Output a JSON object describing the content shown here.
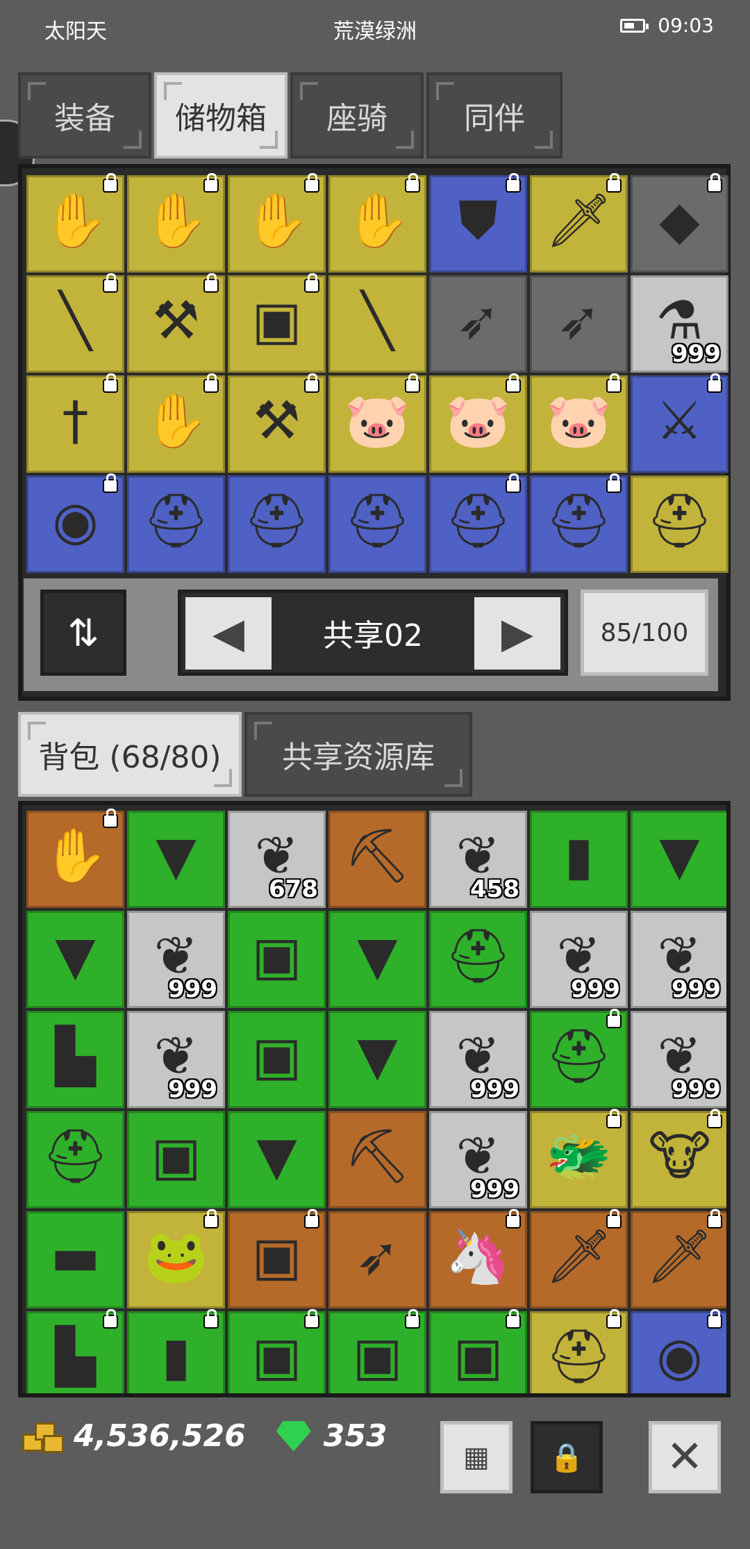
{
  "status_bar": {
    "weather": "太阳天",
    "location": "荒漠绿洲",
    "time": "09:03"
  },
  "top_tabs": [
    {
      "label": "装备",
      "active": false
    },
    {
      "label": "储物箱",
      "active": true
    },
    {
      "label": "座骑",
      "active": false
    },
    {
      "label": "同伴",
      "active": false
    }
  ],
  "storage": {
    "page_label": "共享02",
    "capacity": "85/100",
    "items": [
      {
        "color": "yellow",
        "icon": "gauntlet-icon",
        "glyph": "✋",
        "locked": true,
        "qty": ""
      },
      {
        "color": "yellow",
        "icon": "gauntlet-icon",
        "glyph": "✋",
        "locked": true,
        "qty": ""
      },
      {
        "color": "yellow",
        "icon": "gauntlet-icon",
        "glyph": "✋",
        "locked": true,
        "qty": ""
      },
      {
        "color": "yellow",
        "icon": "gauntlet-icon",
        "glyph": "✋",
        "locked": true,
        "qty": ""
      },
      {
        "color": "blue",
        "icon": "shield-icon",
        "glyph": "⛊",
        "locked": true,
        "qty": ""
      },
      {
        "color": "yellow",
        "icon": "sword-icon",
        "glyph": "🗡",
        "locked": true,
        "qty": ""
      },
      {
        "color": "gray",
        "icon": "gem-bag-icon",
        "glyph": "◆",
        "locked": true,
        "qty": ""
      },
      {
        "color": "yellow",
        "icon": "red-spear-icon",
        "glyph": "╲",
        "locked": true,
        "qty": ""
      },
      {
        "color": "yellow",
        "icon": "axe-icon",
        "glyph": "⚒",
        "locked": true,
        "qty": ""
      },
      {
        "color": "yellow",
        "icon": "leather-armor-icon",
        "glyph": "▣",
        "locked": true,
        "qty": ""
      },
      {
        "color": "yellow",
        "icon": "red-spear-icon",
        "glyph": "╲",
        "locked": false,
        "qty": ""
      },
      {
        "color": "gray",
        "icon": "crossbow-icon",
        "glyph": "➶",
        "locked": false,
        "qty": ""
      },
      {
        "color": "gray",
        "icon": "bow-icon",
        "glyph": "➶",
        "locked": false,
        "qty": ""
      },
      {
        "color": "silver",
        "icon": "potion-icon",
        "glyph": "⚗",
        "locked": false,
        "qty": "999"
      },
      {
        "color": "yellow",
        "icon": "dagger-icon",
        "glyph": "†",
        "locked": true,
        "qty": ""
      },
      {
        "color": "yellow",
        "icon": "gauntlet-icon",
        "glyph": "✋",
        "locked": true,
        "qty": ""
      },
      {
        "color": "yellow",
        "icon": "hammer-icon",
        "glyph": "⚒",
        "locked": true,
        "qty": ""
      },
      {
        "color": "yellow",
        "icon": "pig-pet-icon",
        "glyph": "🐷",
        "locked": true,
        "qty": ""
      },
      {
        "color": "yellow",
        "icon": "pig-pet-icon",
        "glyph": "🐷",
        "locked": true,
        "qty": ""
      },
      {
        "color": "yellow",
        "icon": "pig-pet-icon",
        "glyph": "🐷",
        "locked": true,
        "qty": ""
      },
      {
        "color": "blue",
        "icon": "crossed-swords-icon",
        "glyph": "⚔",
        "locked": true,
        "qty": ""
      },
      {
        "color": "blue",
        "icon": "amulet-icon",
        "glyph": "◉",
        "locked": true,
        "qty": ""
      },
      {
        "color": "blue",
        "icon": "horned-helmet-icon",
        "glyph": "⛑",
        "locked": false,
        "qty": ""
      },
      {
        "color": "blue",
        "icon": "horned-helmet-icon",
        "glyph": "⛑",
        "locked": false,
        "qty": ""
      },
      {
        "color": "blue",
        "icon": "horned-helmet-icon",
        "glyph": "⛑",
        "locked": false,
        "qty": ""
      },
      {
        "color": "blue",
        "icon": "horned-helmet-icon",
        "glyph": "⛑",
        "locked": true,
        "qty": ""
      },
      {
        "color": "blue",
        "icon": "horned-helmet-icon",
        "glyph": "⛑",
        "locked": true,
        "qty": ""
      },
      {
        "color": "yellow",
        "icon": "horned-helmet-icon",
        "glyph": "⛑",
        "locked": false,
        "qty": ""
      }
    ]
  },
  "bottom_tabs": [
    {
      "label": "背包 (68/80)",
      "active": true
    },
    {
      "label": "共享资源库",
      "active": false
    }
  ],
  "backpack": {
    "items": [
      {
        "color": "orange",
        "icon": "fire-gauntlet-icon",
        "glyph": "✋",
        "locked": true,
        "qty": ""
      },
      {
        "color": "green",
        "icon": "wooden-mask-icon",
        "glyph": "▼",
        "locked": false,
        "qty": ""
      },
      {
        "color": "silver",
        "icon": "red-feather-icon",
        "glyph": "❦",
        "locked": false,
        "qty": "678"
      },
      {
        "color": "orange",
        "icon": "pickaxe-icon",
        "glyph": "⛏",
        "locked": false,
        "qty": ""
      },
      {
        "color": "silver",
        "icon": "blue-feather-icon",
        "glyph": "❦",
        "locked": false,
        "qty": "458"
      },
      {
        "color": "green",
        "icon": "red-robe-icon",
        "glyph": "▮",
        "locked": false,
        "qty": ""
      },
      {
        "color": "green",
        "icon": "wooden-mask-icon",
        "glyph": "▼",
        "locked": false,
        "qty": ""
      },
      {
        "color": "green",
        "icon": "wooden-mask-icon",
        "glyph": "▼",
        "locked": false,
        "qty": ""
      },
      {
        "color": "silver",
        "icon": "red-feather-icon",
        "glyph": "❦",
        "locked": false,
        "qty": "999"
      },
      {
        "color": "green",
        "icon": "bronze-armor-icon",
        "glyph": "▣",
        "locked": false,
        "qty": ""
      },
      {
        "color": "green",
        "icon": "wooden-mask-icon",
        "glyph": "▼",
        "locked": false,
        "qty": ""
      },
      {
        "color": "green",
        "icon": "knight-helmet-icon",
        "glyph": "⛑",
        "locked": false,
        "qty": ""
      },
      {
        "color": "silver",
        "icon": "red-feather-icon",
        "glyph": "❦",
        "locked": false,
        "qty": "999"
      },
      {
        "color": "silver",
        "icon": "blue-feather-icon",
        "glyph": "❦",
        "locked": false,
        "qty": "999"
      },
      {
        "color": "green",
        "icon": "iron-boot-icon",
        "glyph": "▙",
        "locked": false,
        "qty": ""
      },
      {
        "color": "silver",
        "icon": "red-feather-icon",
        "glyph": "❦",
        "locked": false,
        "qty": "999"
      },
      {
        "color": "green",
        "icon": "dark-armor-icon",
        "glyph": "▣",
        "locked": false,
        "qty": ""
      },
      {
        "color": "green",
        "icon": "wooden-mask-icon",
        "glyph": "▼",
        "locked": false,
        "qty": ""
      },
      {
        "color": "silver",
        "icon": "red-feather-icon",
        "glyph": "❦",
        "locked": false,
        "qty": "999"
      },
      {
        "color": "green",
        "icon": "knight-helmet-icon",
        "glyph": "⛑",
        "locked": true,
        "qty": ""
      },
      {
        "color": "silver",
        "icon": "blue-feather-icon",
        "glyph": "❦",
        "locked": false,
        "qty": "999"
      },
      {
        "color": "green",
        "icon": "knight-helmet-icon",
        "glyph": "⛑",
        "locked": false,
        "qty": ""
      },
      {
        "color": "green",
        "icon": "bronze-armor-icon",
        "glyph": "▣",
        "locked": false,
        "qty": ""
      },
      {
        "color": "green",
        "icon": "wooden-mask-icon",
        "glyph": "▼",
        "locked": false,
        "qty": ""
      },
      {
        "color": "orange",
        "icon": "pickaxe-icon",
        "glyph": "⛏",
        "locked": false,
        "qty": ""
      },
      {
        "color": "silver",
        "icon": "red-feather-icon",
        "glyph": "❦",
        "locked": false,
        "qty": "999"
      },
      {
        "color": "yellow",
        "icon": "dragon-pet-icon",
        "glyph": "🐲",
        "locked": true,
        "qty": ""
      },
      {
        "color": "yellow",
        "icon": "cow-pet-icon",
        "glyph": "🐮",
        "locked": true,
        "qty": ""
      },
      {
        "color": "green",
        "icon": "blue-belt-icon",
        "glyph": "▬",
        "locked": false,
        "qty": ""
      },
      {
        "color": "yellow",
        "icon": "frog-pet-icon",
        "glyph": "🐸",
        "locked": true,
        "qty": ""
      },
      {
        "color": "orange",
        "icon": "green-armor-icon",
        "glyph": "▣",
        "locked": true,
        "qty": ""
      },
      {
        "color": "orange",
        "icon": "crossbow-icon",
        "glyph": "➶",
        "locked": false,
        "qty": ""
      },
      {
        "color": "orange",
        "icon": "unicorn-pet-icon",
        "glyph": "🦄",
        "locked": true,
        "qty": ""
      },
      {
        "color": "orange",
        "icon": "golden-sword-icon",
        "glyph": "🗡",
        "locked": true,
        "qty": ""
      },
      {
        "color": "orange",
        "icon": "golden-sword-icon",
        "glyph": "🗡",
        "locked": true,
        "qty": ""
      },
      {
        "color": "green",
        "icon": "boots-icon",
        "glyph": "▙",
        "locked": true,
        "qty": ""
      },
      {
        "color": "green",
        "icon": "red-robe-icon",
        "glyph": "▮",
        "locked": true,
        "qty": ""
      },
      {
        "color": "green",
        "icon": "blue-armor-icon",
        "glyph": "▣",
        "locked": true,
        "qty": ""
      },
      {
        "color": "green",
        "icon": "blue-armor-icon",
        "glyph": "▣",
        "locked": true,
        "qty": ""
      },
      {
        "color": "green",
        "icon": "leather-armor-icon",
        "glyph": "▣",
        "locked": true,
        "qty": ""
      },
      {
        "color": "yellow",
        "icon": "golden-helmet-icon",
        "glyph": "⛑",
        "locked": true,
        "qty": ""
      },
      {
        "color": "blue",
        "icon": "gold-amulet-icon",
        "glyph": "◉",
        "locked": true,
        "qty": ""
      }
    ]
  },
  "footer": {
    "gold": "4,536,526",
    "gems": "353"
  },
  "colors": {
    "background": "#5c5c5c",
    "yellow_slot": "#c2b33a",
    "blue_slot": "#4f61c4",
    "green_slot": "#2fb02a",
    "orange_slot": "#b56a2a",
    "silver_slot": "#c6c6c6"
  }
}
